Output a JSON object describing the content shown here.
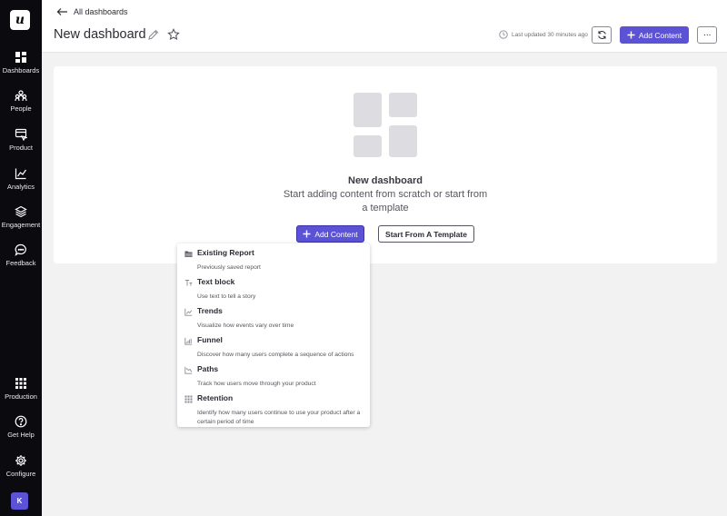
{
  "sidebar": {
    "logo": "u",
    "items": [
      {
        "label": "Dashboards",
        "icon": "dashboard-icon"
      },
      {
        "label": "People",
        "icon": "people-icon"
      },
      {
        "label": "Product",
        "icon": "product-icon"
      },
      {
        "label": "Analytics",
        "icon": "analytics-icon"
      },
      {
        "label": "Engagement",
        "icon": "engagement-icon"
      },
      {
        "label": "Feedback",
        "icon": "feedback-icon"
      }
    ],
    "bottom_items": [
      {
        "label": "Production",
        "icon": "grid-icon"
      },
      {
        "label": "Get Help",
        "icon": "help-icon"
      },
      {
        "label": "Configure",
        "icon": "gear-icon"
      }
    ],
    "avatar": "K"
  },
  "header": {
    "back_label": "All dashboards",
    "title": "New dashboard",
    "last_updated": "Last updated 30 minutes ago",
    "add_content_label": "Add Content",
    "more_label": "···"
  },
  "empty_state": {
    "title": "New dashboard",
    "subtitle": "Start adding content from scratch or start from a template",
    "add_content_label": "Add Content",
    "template_label": "Start From A Template"
  },
  "dropdown": {
    "items": [
      {
        "title": "Existing Report",
        "desc": "Previously saved report",
        "icon": "folder-icon"
      },
      {
        "title": "Text block",
        "desc": "Use text to tell a story",
        "icon": "text-icon"
      },
      {
        "title": "Trends",
        "desc": "Visualize how events vary over time",
        "icon": "trend-icon"
      },
      {
        "title": "Funnel",
        "desc": "Discover how many users complete a sequence of actions",
        "icon": "funnel-icon"
      },
      {
        "title": "Paths",
        "desc": "Track how users move through your product",
        "icon": "paths-icon"
      },
      {
        "title": "Retention",
        "desc": "Identify how many users continue to use your product after a certain period of time",
        "icon": "retention-icon"
      }
    ]
  },
  "colors": {
    "sidebar_bg": "#0b0b0f",
    "accent": "#5b52d6",
    "page_bg": "#f2f2f3"
  }
}
